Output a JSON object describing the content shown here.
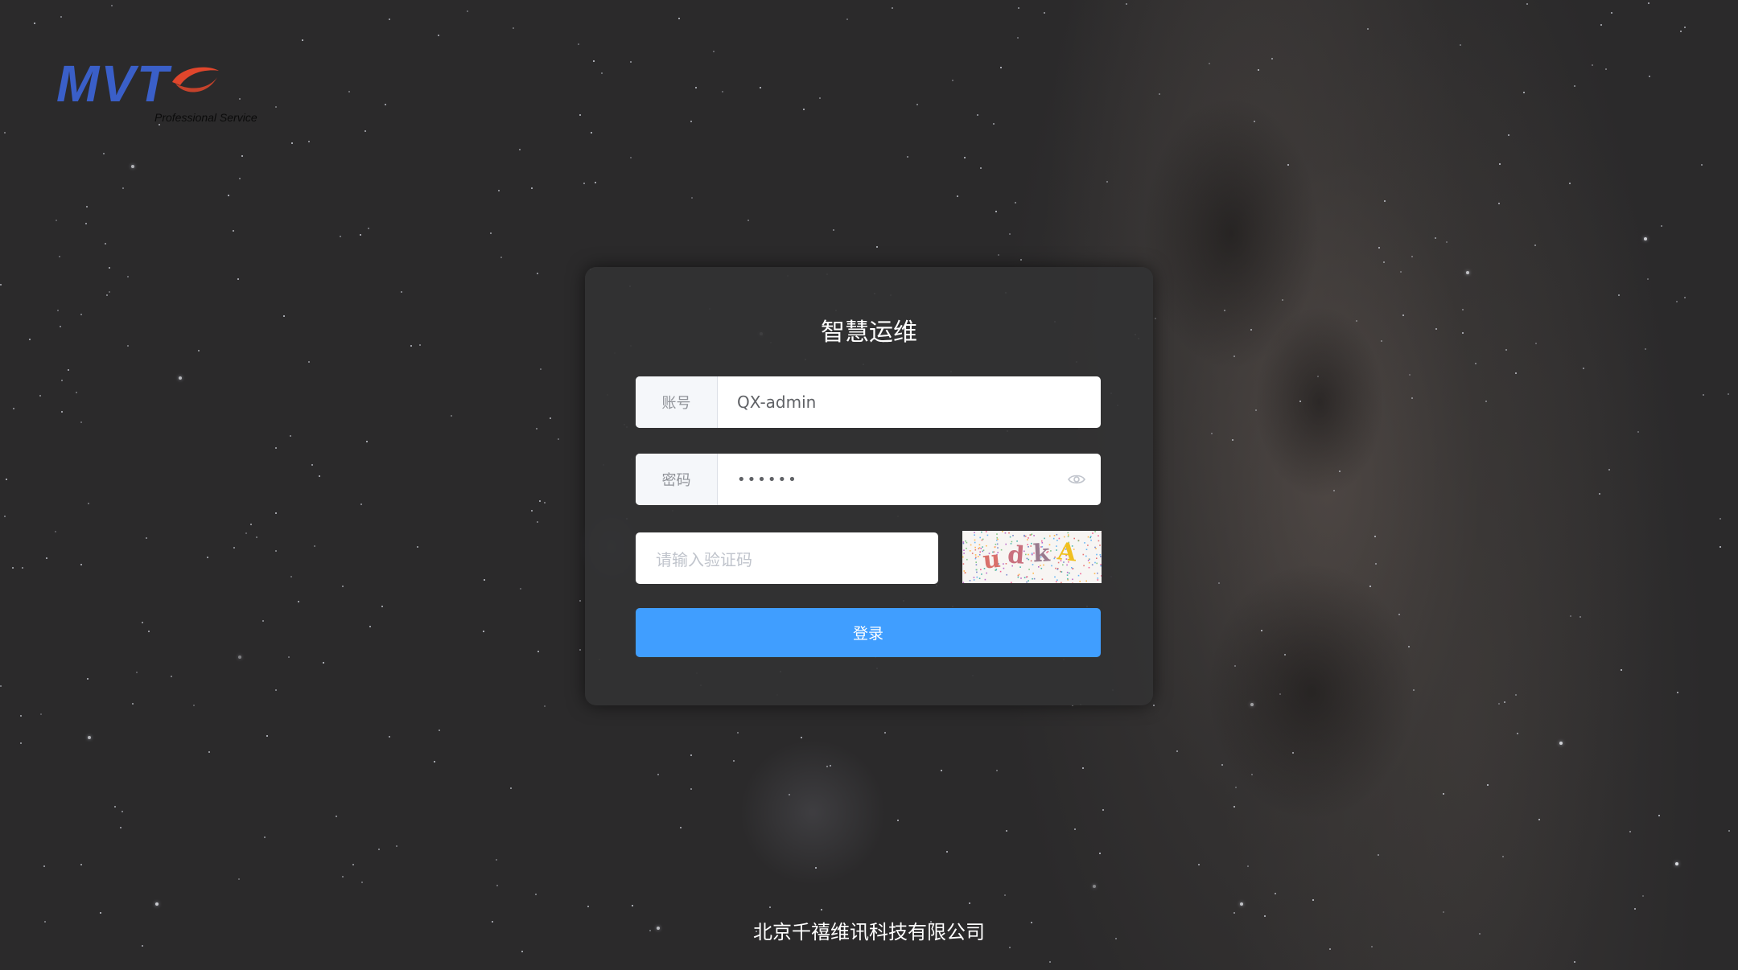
{
  "brand": {
    "logo_text": "MVT",
    "tagline": "Professional Service",
    "logo_color": "#3a5fc8",
    "swoosh_color": "#e0462c"
  },
  "login": {
    "title": "智慧运维",
    "account_label": "账号",
    "account_value": "QX-admin",
    "password_label": "密码",
    "password_value": "••••••",
    "password_toggle_icon": "eye-icon",
    "captcha_placeholder": "请输入验证码",
    "captcha_text": "udkA",
    "submit_label": "登录",
    "accent_color": "#409eff"
  },
  "footer": {
    "company": "北京千禧维讯科技有限公司"
  }
}
